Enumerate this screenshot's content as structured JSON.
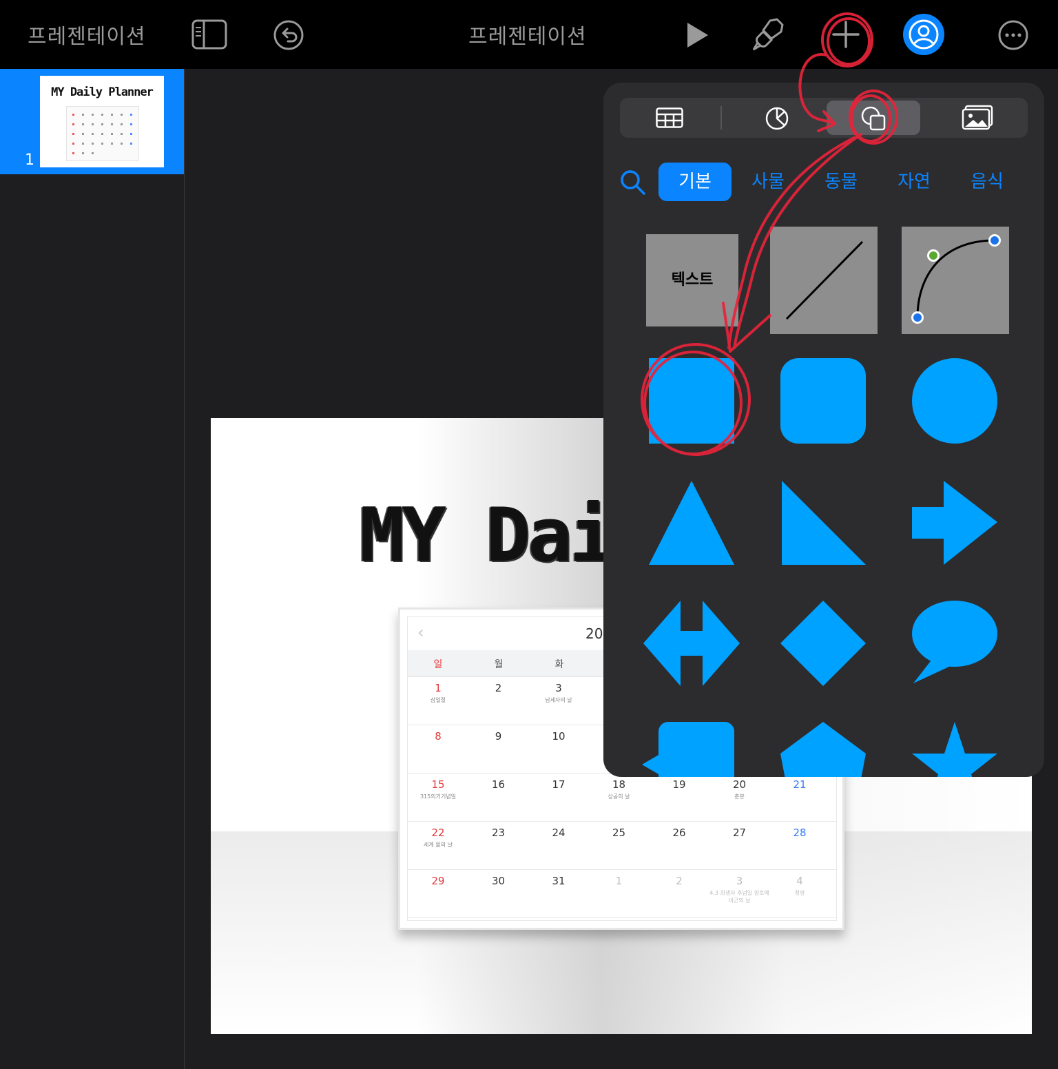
{
  "toolbar": {
    "left_title": "프레젠테이션",
    "center_title": "프레젠테이션",
    "icons": [
      "sidebar-toggle-icon",
      "undo-icon",
      "play-icon",
      "paintbrush-icon",
      "plus-icon",
      "collaborate-icon",
      "more-icon"
    ]
  },
  "sidebar": {
    "slides": [
      {
        "number": "1",
        "thumb_title": "MY Daily Planner"
      }
    ]
  },
  "slide": {
    "title": "MY Dail",
    "calendar": {
      "year_partial": "20",
      "weekdays": [
        "일",
        "월",
        "화"
      ],
      "rows": [
        [
          {
            "n": "1",
            "note": "삼일절",
            "cls": "sun"
          },
          {
            "n": "2"
          },
          {
            "n": "3",
            "note": "납세자의 날"
          }
        ],
        [
          {
            "n": "8",
            "cls": "sun"
          },
          {
            "n": "9"
          },
          {
            "n": "10"
          }
        ],
        [
          {
            "n": "15",
            "note": "315의거기념일",
            "cls": "sun"
          },
          {
            "n": "16"
          },
          {
            "n": "17"
          },
          {
            "n": "18",
            "note": "상공의 날"
          },
          {
            "n": "19"
          },
          {
            "n": "20",
            "note": "춘분"
          },
          {
            "n": "21",
            "cls": "sat"
          }
        ],
        [
          {
            "n": "22",
            "note": "세계 물의 날",
            "cls": "sun"
          },
          {
            "n": "23"
          },
          {
            "n": "24"
          },
          {
            "n": "25"
          },
          {
            "n": "26"
          },
          {
            "n": "27"
          },
          {
            "n": "28",
            "cls": "sat"
          }
        ],
        [
          {
            "n": "29",
            "cls": "sun"
          },
          {
            "n": "30"
          },
          {
            "n": "31"
          },
          {
            "n": "1",
            "cls": "muted"
          },
          {
            "n": "2",
            "cls": "muted"
          },
          {
            "n": "3",
            "note": "4.3 희생자 추념일 향토예비군의 날",
            "cls": "muted"
          },
          {
            "n": "4",
            "note": "청명",
            "cls": "muted"
          }
        ]
      ]
    }
  },
  "popover": {
    "tabs": [
      "table-icon",
      "chart-icon",
      "shapes-icon",
      "media-icon"
    ],
    "active_tab": "shapes-icon",
    "categories": [
      "기본",
      "사물",
      "동물",
      "자연",
      "음식"
    ],
    "active_category": "기본",
    "text_shape_label": "텍스트",
    "shapes": [
      "text",
      "line",
      "curve",
      "square",
      "rounded-square",
      "circle",
      "triangle",
      "right-triangle",
      "arrow",
      "double-arrow",
      "diamond",
      "speech-bubble",
      "callout",
      "pentagon",
      "star"
    ],
    "shape_color": "#00a2ff"
  },
  "accent_color": "#0a84ff",
  "annotation_color": "#e8233a"
}
